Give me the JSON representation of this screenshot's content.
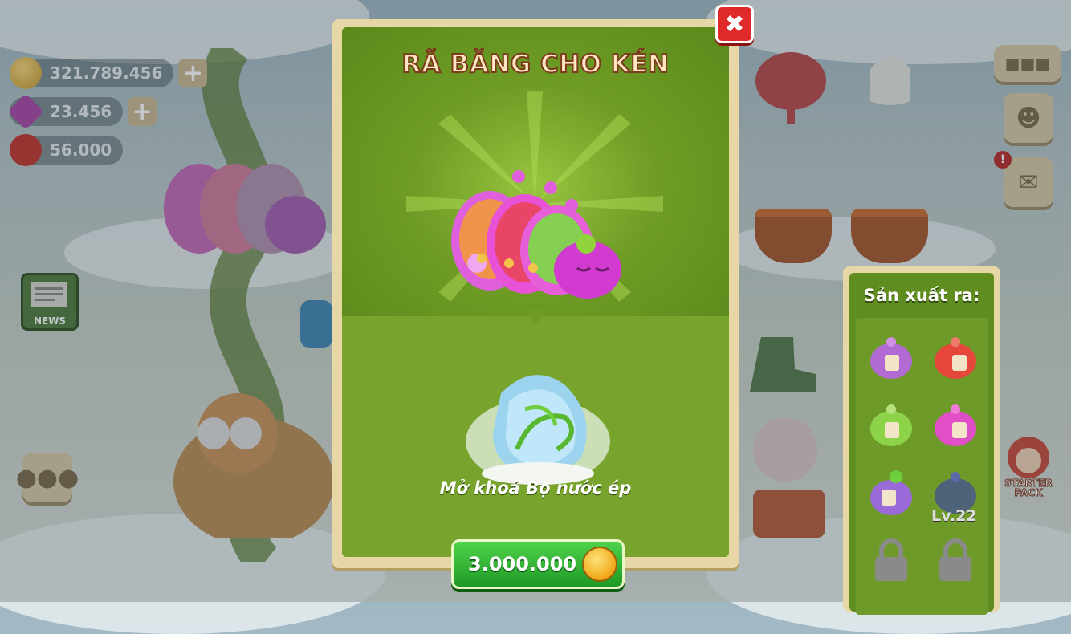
{
  "resources": {
    "gold": "321.789.456",
    "gems": "23.456",
    "hearts": "56.000"
  },
  "side_buttons": {
    "news_label": "NEWS",
    "starter_pack_label": "STARTER PACK"
  },
  "dialog": {
    "title": "RÃ BĂNG CHO KÉN",
    "close_icon": "close-icon",
    "unlock_text": "Mở khoá Bọ nước ép",
    "price": "3.000.000",
    "price_icon": "coin-icon"
  },
  "produce_panel": {
    "title": "Sản xuất ra:",
    "items": [
      {
        "name": "purple-teapot",
        "color": "#b06ad1"
      },
      {
        "name": "red-teapot",
        "color": "#e5473a"
      },
      {
        "name": "green-teapot",
        "color": "#8cd34a"
      },
      {
        "name": "pink-teapot",
        "color": "#e04fc6"
      },
      {
        "name": "grape-teapot",
        "color": "#9a6ad8"
      },
      {
        "name": "dark-teapot",
        "color": "#46548f"
      },
      {
        "name": "locked-teapot",
        "color": "#8a8a8a"
      },
      {
        "name": "locked-teapot",
        "color": "#8a8a8a"
      }
    ],
    "level_label": "Lv.22"
  },
  "colors": {
    "dialog_green": "#5f8d1f",
    "frame_beige": "#e8d7a6",
    "button_green": "#2bb02f",
    "close_red": "#e02a2a"
  }
}
